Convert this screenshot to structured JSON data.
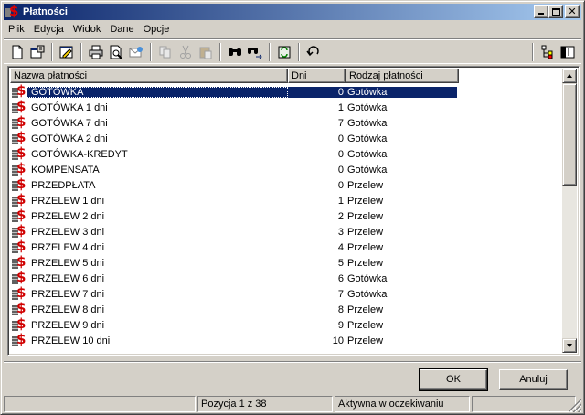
{
  "window": {
    "title": "Płatności"
  },
  "menu": [
    "Plik",
    "Edycja",
    "Widok",
    "Dane",
    "Opcje"
  ],
  "toolbar": {
    "icons": [
      "new-document-icon",
      "properties-icon",
      "edit-icon",
      "print-icon",
      "print-preview-icon",
      "email-icon",
      "copy-icon",
      "cut-icon",
      "paste-icon",
      "find-icon",
      "find-next-icon",
      "refresh-icon",
      "undo-icon",
      "tree-icon",
      "columns-icon"
    ]
  },
  "list": {
    "columns": [
      "Nazwa płatności",
      "Dni",
      "Rodzaj płatności"
    ],
    "rows": [
      {
        "name": "GOTÓWKA",
        "days": "0",
        "type": "Gotówka",
        "selected": true
      },
      {
        "name": "GOTÓWKA 1 dni",
        "days": "1",
        "type": "Gotówka"
      },
      {
        "name": "GOTÓWKA 7 dni",
        "days": "7",
        "type": "Gotówka"
      },
      {
        "name": "GOTÓWKA 2 dni",
        "days": "0",
        "type": "Gotówka"
      },
      {
        "name": "GOTÓWKA-KREDYT",
        "days": "0",
        "type": "Gotówka"
      },
      {
        "name": "KOMPENSATA",
        "days": "0",
        "type": "Gotówka"
      },
      {
        "name": "PRZEDPŁATA",
        "days": "0",
        "type": "Przelew"
      },
      {
        "name": "PRZELEW 1 dni",
        "days": "1",
        "type": "Przelew"
      },
      {
        "name": "PRZELEW 2 dni",
        "days": "2",
        "type": "Przelew"
      },
      {
        "name": "PRZELEW 3 dni",
        "days": "3",
        "type": "Przelew"
      },
      {
        "name": "PRZELEW 4 dni",
        "days": "4",
        "type": "Przelew"
      },
      {
        "name": "PRZELEW 5 dni",
        "days": "5",
        "type": "Przelew"
      },
      {
        "name": "PRZELEW 6 dni",
        "days": "6",
        "type": "Gotówka"
      },
      {
        "name": "PRZELEW 7 dni",
        "days": "7",
        "type": "Gotówka"
      },
      {
        "name": "PRZELEW 8 dni",
        "days": "8",
        "type": "Przelew"
      },
      {
        "name": "PRZELEW 9 dni",
        "days": "9",
        "type": "Przelew"
      },
      {
        "name": "PRZELEW 10 dni",
        "days": "10",
        "type": "Przelew"
      }
    ]
  },
  "buttons": {
    "ok": "OK",
    "cancel": "Anuluj"
  },
  "status": {
    "left": "",
    "position": "Pozycja 1 z 38",
    "state": "Aktywna w oczekiwaniu",
    "extra": ""
  }
}
